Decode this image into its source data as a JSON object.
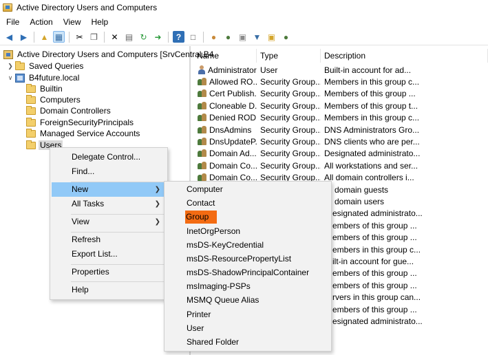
{
  "window": {
    "title": "Active Directory Users and Computers"
  },
  "menubar": [
    "File",
    "Action",
    "View",
    "Help"
  ],
  "toolbar": {
    "buttons": [
      "back-icon",
      "forward-icon",
      "up-folder-icon",
      "console-tree-icon",
      "cut-icon",
      "copy-icon",
      "delete-icon",
      "properties-icon",
      "refresh-icon",
      "export-icon",
      "help-icon",
      "console-help-icon",
      "new-user-icon",
      "new-group-icon",
      "new-ou-icon",
      "filter-icon",
      "find-icon",
      "add-to-group-icon"
    ]
  },
  "tree": {
    "root": "Active Directory Users and Computers [SrvCentral.B4",
    "saved_queries": "Saved Queries",
    "domain": "B4future.local",
    "children": [
      "Builtin",
      "Computers",
      "Domain Controllers",
      "ForeignSecurityPrincipals",
      "Managed Service Accounts",
      "Users"
    ]
  },
  "list": {
    "columns": [
      "Name",
      "Type",
      "Description"
    ],
    "rows": [
      {
        "name": "Administrator",
        "type": "User",
        "desc": "Built-in account for ad...",
        "icon": "user"
      },
      {
        "name": "Allowed RO...",
        "type": "Security Group...",
        "desc": "Members in this group c...",
        "icon": "group"
      },
      {
        "name": "Cert Publish...",
        "type": "Security Group...",
        "desc": "Members of this group ...",
        "icon": "group"
      },
      {
        "name": "Cloneable D...",
        "type": "Security Group...",
        "desc": "Members of this group t...",
        "icon": "group"
      },
      {
        "name": "Denied ROD...",
        "type": "Security Group...",
        "desc": "Members in this group c...",
        "icon": "group"
      },
      {
        "name": "DnsAdmins",
        "type": "Security Group...",
        "desc": "DNS Administrators Gro...",
        "icon": "group"
      },
      {
        "name": "DnsUpdateP...",
        "type": "Security Group...",
        "desc": "DNS clients who are per...",
        "icon": "group"
      },
      {
        "name": "Domain Ad...",
        "type": "Security Group...",
        "desc": "Designated administrato...",
        "icon": "group"
      },
      {
        "name": "Domain Co...",
        "type": "Security Group...",
        "desc": "All workstations and ser...",
        "icon": "group"
      },
      {
        "name": "Domain Co...",
        "type": "Security Group...",
        "desc": "All domain controllers i...",
        "icon": "group"
      }
    ],
    "desc_tail": [
      "domain guests",
      "domain users",
      "esignated administrato...",
      "embers of this group ...",
      "embers of this group ...",
      "embers in this group c...",
      "ilt-in account for gue...",
      "embers of this group ...",
      "embers of this group ...",
      "rvers in this group can...",
      "embers of this group ...",
      "esignated administrato..."
    ]
  },
  "context_menu": {
    "items": [
      {
        "label": "Delegate Control..."
      },
      {
        "label": "Find..."
      },
      {
        "label": "New",
        "submenu": true,
        "hover": true
      },
      {
        "label": "All Tasks",
        "submenu": true
      },
      {
        "label": "View",
        "submenu": true
      },
      {
        "label": "Refresh"
      },
      {
        "label": "Export List..."
      },
      {
        "label": "Properties"
      },
      {
        "label": "Help"
      }
    ]
  },
  "new_submenu": {
    "items": [
      "Computer",
      "Contact",
      "Group",
      "InetOrgPerson",
      "msDS-KeyCredential",
      "msDS-ResourcePropertyList",
      "msDS-ShadowPrincipalContainer",
      "msImaging-PSPs",
      "MSMQ Queue Alias",
      "Printer",
      "User",
      "Shared Folder"
    ],
    "highlighted": "Group",
    "highlight_color": "#f36b12"
  }
}
